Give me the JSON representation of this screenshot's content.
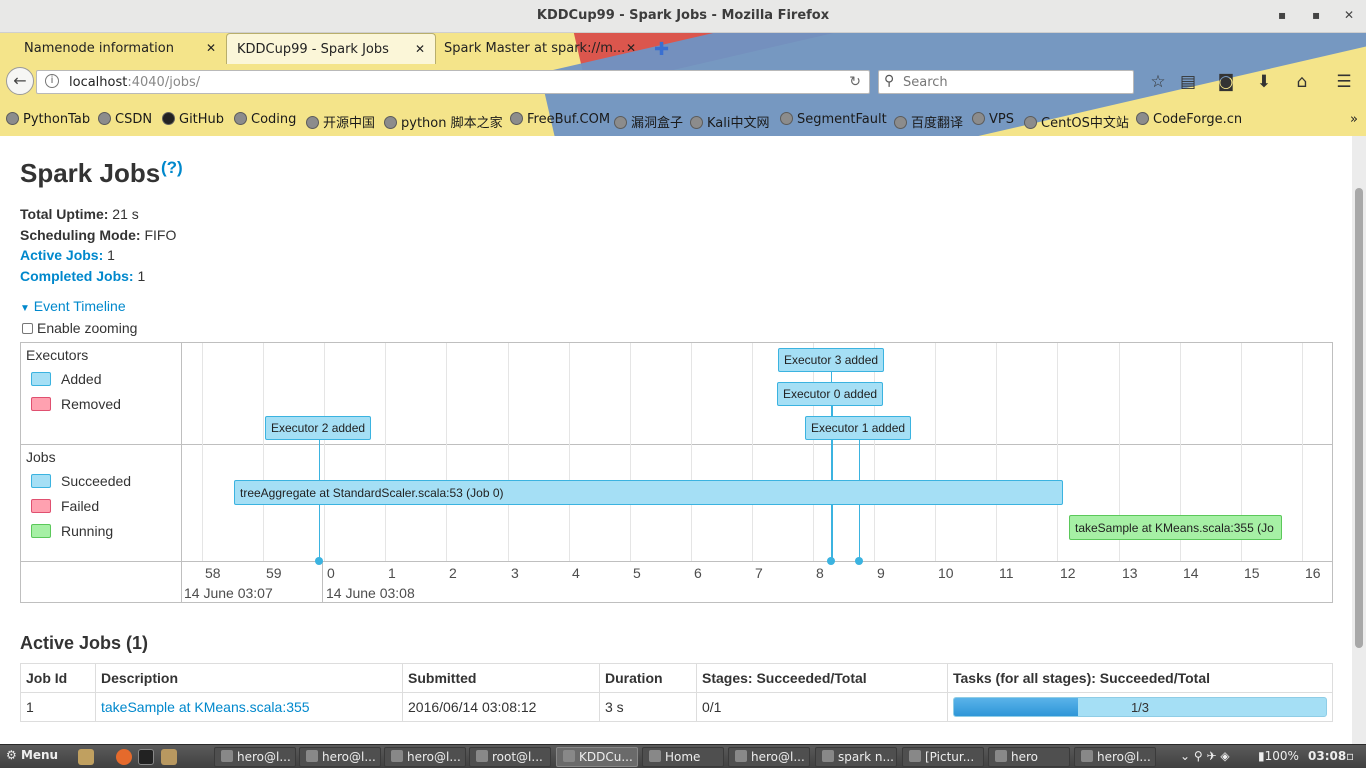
{
  "window": {
    "title": "KDDCup99 - Spark Jobs - Mozilla Firefox"
  },
  "tabs": [
    {
      "label": "Namenode information"
    },
    {
      "label": "KDDCup99 - Spark Jobs"
    },
    {
      "label": "Spark Master at spark://m..."
    }
  ],
  "nav": {
    "url_host": "localhost",
    "url_rest": ":4040/jobs/",
    "search_placeholder": "Search"
  },
  "bookmarks": [
    "PythonTab",
    "CSDN",
    "GitHub",
    "Coding",
    "开源中国",
    "python 脚本之家",
    "FreeBuf.COM",
    "漏洞盒子",
    "Kali中文网",
    "SegmentFault",
    "百度翻译",
    "VPS",
    "CentOS中文站",
    "CodeForge.cn"
  ],
  "page": {
    "title": "Spark Jobs",
    "help": "(?)",
    "uptime_label": "Total Uptime:",
    "uptime_value": "21 s",
    "mode_label": "Scheduling Mode:",
    "mode_value": "FIFO",
    "active_label": "Active Jobs:",
    "active_value": "1",
    "completed_label": "Completed Jobs:",
    "completed_value": "1",
    "event_timeline": "Event Timeline",
    "enable_zooming": "Enable zooming"
  },
  "timeline": {
    "executors_group": "Executors",
    "jobs_group": "Jobs",
    "legend_executors": [
      {
        "label": "Added",
        "color": "#a5dff5"
      },
      {
        "label": "Removed",
        "color": "#ffa1b0"
      }
    ],
    "legend_jobs": [
      {
        "label": "Succeeded",
        "color": "#a5dff5"
      },
      {
        "label": "Failed",
        "color": "#ffa1b0"
      },
      {
        "label": "Running",
        "color": "#a6f0a5"
      }
    ],
    "ticks": [
      "58",
      "59",
      "0",
      "1",
      "2",
      "3",
      "4",
      "5",
      "6",
      "7",
      "8",
      "9",
      "10",
      "11",
      "12",
      "13",
      "14",
      "15",
      "16"
    ],
    "date_labels": [
      "14 June 03:07",
      "14 June 03:08"
    ],
    "executor_events": [
      "Executor 3 added",
      "Executor 0 added",
      "Executor 2 added",
      "Executor 1 added"
    ],
    "jobs": [
      {
        "label": "treeAggregate at StandardScaler.scala:53 (Job 0)",
        "status": "succeeded"
      },
      {
        "label": "takeSample at KMeans.scala:355 (Jo",
        "status": "running"
      }
    ]
  },
  "active_jobs": {
    "heading": "Active Jobs (1)",
    "columns": [
      "Job Id",
      "Description",
      "Submitted",
      "Duration",
      "Stages: Succeeded/Total",
      "Tasks (for all stages): Succeeded/Total"
    ],
    "rows": [
      {
        "id": "1",
        "description": "takeSample at KMeans.scala:355",
        "submitted": "2016/06/14 03:08:12",
        "duration": "3 s",
        "stages": "0/1",
        "tasks": "1/3",
        "tasks_fraction": 0.333
      }
    ]
  },
  "taskbar": {
    "menu": "Menu",
    "items": [
      "hero@l...",
      "hero@l...",
      "hero@l...",
      "root@l...",
      "KDDCu...",
      "Home",
      "hero@l...",
      "spark n...",
      "[Pictur...",
      "hero",
      "hero@l..."
    ],
    "battery": "100%",
    "clock": "03:08"
  }
}
